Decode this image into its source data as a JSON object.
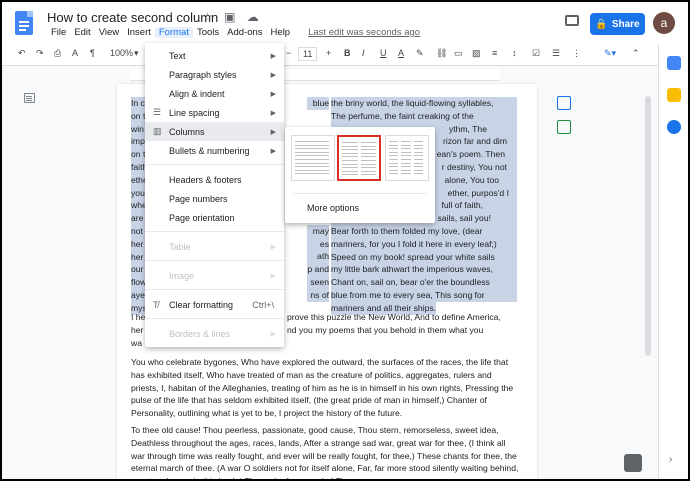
{
  "title": "How to create second column",
  "menubar": [
    "File",
    "Edit",
    "View",
    "Insert",
    "Format",
    "Tools",
    "Add-ons",
    "Help"
  ],
  "last_edit": "Last edit was seconds ago",
  "share_label": "Share",
  "avatar_letter": "a",
  "toolbar": {
    "zoom": "100%",
    "font_size": "11"
  },
  "format_menu": [
    {
      "label": "Text",
      "submenu": true
    },
    {
      "label": "Paragraph styles",
      "submenu": true
    },
    {
      "label": "Align & indent",
      "submenu": true
    },
    {
      "label": "Line spacing",
      "submenu": true
    },
    {
      "label": "Columns",
      "submenu": true
    },
    {
      "label": "Bullets & numbering",
      "submenu": true
    },
    {
      "label": "Headers & footers"
    },
    {
      "label": "Page numbers"
    },
    {
      "label": "Page orientation"
    },
    {
      "label": "Table",
      "submenu": true,
      "disabled": true
    },
    {
      "label": "Image",
      "submenu": true,
      "disabled": true
    },
    {
      "label": "Clear formatting",
      "shortcut": "Ctrl+\\"
    },
    {
      "label": "Borders & lines",
      "submenu": true,
      "disabled": true
    }
  ],
  "columns_submenu": {
    "more_options": "More options"
  },
  "doc": {
    "left_col": [
      "In c",
      "on t",
      "win",
      "imp",
      "on t",
      "faith",
      "ethe",
      "you",
      "whe",
      "are",
      "not",
      "her",
      "her",
      "our",
      "flow",
      "aye",
      "mys"
    ],
    "left_col_right": [
      "blue",
      "",
      "",
      "",
      "",
      "",
      "",
      "",
      "",
      "",
      "may",
      "es",
      "ath",
      "p and",
      "seen",
      "ns of"
    ],
    "right_col": [
      "the briny world, the liquid-flowing syllables,",
      "The perfume, the faint creaking of the",
      "ythm, The",
      "rizon far and dim",
      "ean's poem. Then",
      "r destiny, You not",
      "alone, You too",
      "ether, purpos'd I",
      "full of faith,",
      "sails, sail you!",
      "Bear forth to them folded my love, (dear",
      "mariners, for you I fold it here in every leaf;)",
      "Speed on my book! spread your white sails",
      "my little bark athwart the imperious waves,",
      "Chant on, sail on, bear o'er the boundless",
      "blue from me to every sea, This song for",
      "mariners and all their ships."
    ],
    "para1": [
      "I he",
      "prove this puzzle the New World, And to define America,",
      "her",
      "nd you my poems that you behold in them what you",
      "wa"
    ],
    "para2": "You who celebrate bygones, Who have explored the outward, the surfaces of the races, the life that has exhibited itself, Who have treated of man as the creature of politics, aggregates, rulers and priests, I, habitan of the Alleghanies, treating of him as he is in himself in his own rights, Pressing the pulse of the life that has seldom exhibited itself, (the great pride of man in himself,) Chanter of Personality, outlining what is yet to be, I project the history of the future.",
    "para3": "To thee old cause! Thou peerless, passionate, good cause, Thou stern, remorseless, sweet idea, Deathless throughout the ages, races, lands, After a strange sad war, great war for thee, (I think all war through time was really fought, and ever will be really fought, for thee,) These chants for thee, the eternal march of thee. (A war O soldiers not for itself alone, Far, far more stood silently waiting behind, now to advance in this book.) Thou orb of many orbs! Thou"
  },
  "colors": {
    "accent": "#1a73e8",
    "selection": "#c8d4e6",
    "highlight_border": "#d93025"
  }
}
